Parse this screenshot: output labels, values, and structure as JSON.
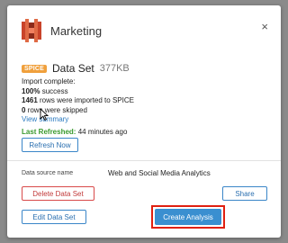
{
  "dialog": {
    "title": "Marketing",
    "close_label": "×"
  },
  "dataset": {
    "badge": "SPICE",
    "label": "Data Set",
    "size": "377KB"
  },
  "import_status": {
    "heading": "Import complete:",
    "success_bold": "100%",
    "success_rest": " success",
    "imported_bold": "1461",
    "imported_rest": " rows were imported to SPICE",
    "skipped_bold": "0",
    "skipped_rest": " rows were skipped",
    "view_summary": "View summary",
    "last_refreshed_label": "Last Refreshed:",
    "last_refreshed_value": " 44 minutes ago"
  },
  "buttons": {
    "refresh": "Refresh Now",
    "delete": "Delete Data Set",
    "share": "Share",
    "edit": "Edit Data Set",
    "create_analysis": "Create Analysis"
  },
  "data_source": {
    "label": "Data source name",
    "value": "Web and Social Media Analytics"
  },
  "colors": {
    "badge": "#f0a03c",
    "primary": "#3a8fd0",
    "danger": "#d94a4a",
    "success": "#3a9a2e",
    "highlight": "#e02010"
  },
  "icons": {
    "app": "aws-s3-bucket-icon",
    "close": "close-icon",
    "cursor": "mouse-pointer-icon"
  }
}
